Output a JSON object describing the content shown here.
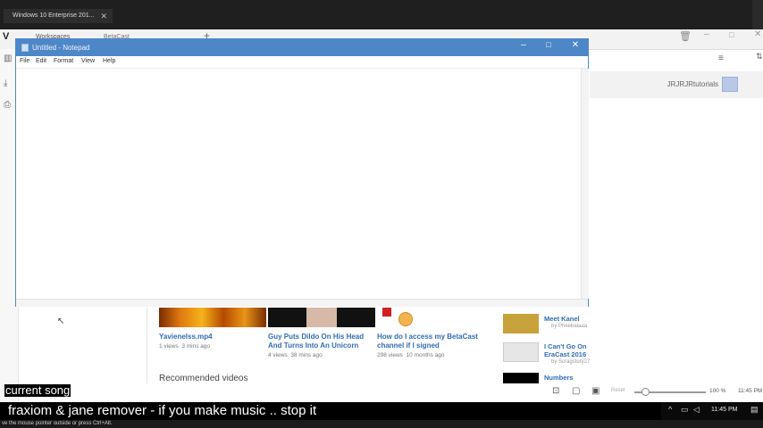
{
  "vm": {
    "tab_title": "Windows 10 Enterprise 201...",
    "tab_close": "✕"
  },
  "browser": {
    "tabs": [
      {
        "label": "Workspaces"
      },
      {
        "label": "BetaCast"
      }
    ],
    "new_tab": "+"
  },
  "notepad": {
    "title": "Untitled - Notepad",
    "menu": [
      "File",
      "Edit",
      "Format",
      "View",
      "Help"
    ],
    "content": ""
  },
  "page": {
    "username": "JRJRJRtutorials",
    "videos": [
      {
        "title": "Yavienelss.mp4",
        "views": "1 views",
        "time": "3 mins ago"
      },
      {
        "title": "Guy Puts Dildo On His Head And Turns Into An Unicorn",
        "views": "4 views",
        "time": "38 mins ago"
      },
      {
        "title": "How do I access my BetaCast channel if I signed",
        "views": "298 views",
        "time": "10 months ago"
      }
    ],
    "recommended_heading": "Recommended videos",
    "side_videos": [
      {
        "title": "Meet Kanel",
        "by": "by Pheebalaaa"
      },
      {
        "title": "I Can't Go On EraCast 2016",
        "by": "by Scragstory27"
      },
      {
        "title": "Numbers",
        "by": ""
      }
    ],
    "zoom": {
      "reset": "Reset",
      "percent": "100 %",
      "level": 0.15
    },
    "toolbar_time": "11:45 PM"
  },
  "overlay": {
    "label": "current song",
    "song": "fraxiom & jane remover - if you make music .. stop it"
  },
  "taskbar": {
    "time": "11:45 PM"
  },
  "status": {
    "text": "ve the mouse pointer outside or press Ctrl+Alt."
  }
}
